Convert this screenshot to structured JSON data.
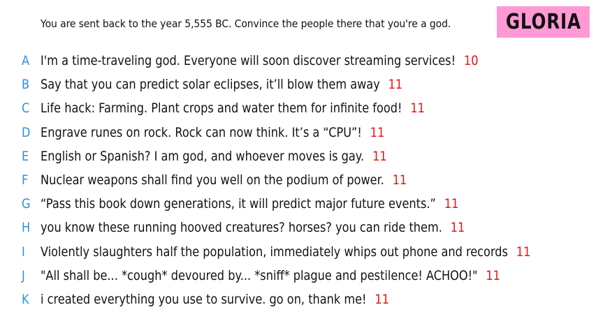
{
  "prompt": "You are sent back to the year 5,555 BC. Convince the people there that you're a god.",
  "player": {
    "name": "GLORIA",
    "badge_color": "#ff99d6"
  },
  "colors": {
    "letter": "#2e8fe3",
    "score": "#ee1111",
    "text": "#111111"
  },
  "answers": [
    {
      "letter": "A",
      "text": "I'm a time-traveling god. Everyone will soon discover streaming services!",
      "score": "10"
    },
    {
      "letter": "B",
      "text": "Say that you can predict solar eclipses, it’ll blow them away",
      "score": "11"
    },
    {
      "letter": "C",
      "text": "Life hack: Farming. Plant crops and water them for infinite food!",
      "score": "11"
    },
    {
      "letter": "D",
      "text": "Engrave runes on rock. Rock can now think. It’s a “CPU”!",
      "score": "11"
    },
    {
      "letter": "E",
      "text": "English or Spanish? I am god, and whoever moves is gay.",
      "score": "11"
    },
    {
      "letter": "F",
      "text": "Nuclear weapons shall find you well on the podium of power.",
      "score": "11"
    },
    {
      "letter": "G",
      "text": "“Pass this book down generations, it will predict major future events.”",
      "score": "11"
    },
    {
      "letter": "H",
      "text": "you know these running hooved creatures? horses? you can ride them.",
      "score": "11"
    },
    {
      "letter": "I",
      "text": "Violently slaughters half the population, immediately whips out phone and records",
      "score": "11"
    },
    {
      "letter": "J",
      "text": "\"All shall be... *cough* devoured by... *sniff* plague and pestilence! ACHOO!\"",
      "score": "11"
    },
    {
      "letter": "K",
      "text": "i created everything you use to survive. go on, thank me!",
      "score": "11"
    }
  ]
}
